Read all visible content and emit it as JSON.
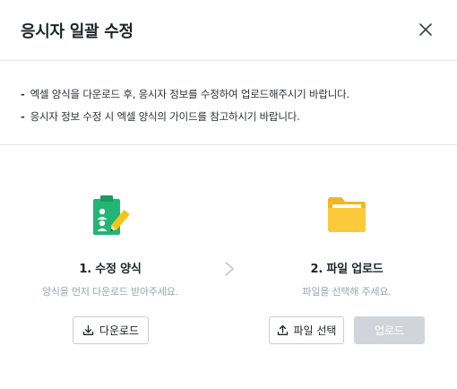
{
  "modal": {
    "title": "응시자 일괄 수정",
    "close_icon": "close-icon"
  },
  "notes": [
    "엑셀 양식을 다운로드 후, 응시자 정보를 수정하여 업로드해주시기 바랍니다.",
    "응시자 정보 수정 시 엑셀 양식의 가이드를 참고하시기 바랍니다."
  ],
  "note_bullet": "-",
  "steps": [
    {
      "icon": "clipboard-users-icon",
      "title": "1. 수정 양식",
      "description": "양식을 먼저 다운로드 받아주세요."
    },
    {
      "icon": "folder-icon",
      "title": "2. 파일 업로드",
      "description": "파일을 선택해 주세요."
    }
  ],
  "buttons": {
    "download": {
      "label": "다운로드",
      "icon": "download-icon"
    },
    "choose_file": {
      "label": "파일 선택",
      "icon": "upload-icon"
    },
    "upload": {
      "label": "업로드",
      "disabled": true
    }
  },
  "colors": {
    "clipboard_green": "#22b573",
    "clipboard_pencil": "#f5c518",
    "folder_yellow": "#f7c531",
    "disabled_button": "#d1d5db",
    "divider": "#e5e7eb"
  }
}
